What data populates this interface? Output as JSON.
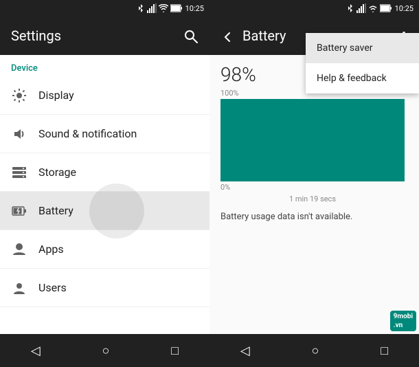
{
  "left": {
    "status_bar": {
      "time": "10:25"
    },
    "app_bar": {
      "title": "Settings",
      "search_icon": "🔍"
    },
    "section": {
      "label": "Device"
    },
    "menu_items": [
      {
        "id": "display",
        "label": "Display",
        "icon": "☀"
      },
      {
        "id": "sound",
        "label": "Sound & notification",
        "icon": "🔔"
      },
      {
        "id": "storage",
        "label": "Storage",
        "icon": "☰"
      },
      {
        "id": "battery",
        "label": "Battery",
        "icon": "🔋",
        "active": true
      },
      {
        "id": "apps",
        "label": "Apps",
        "icon": "🤖"
      },
      {
        "id": "users",
        "label": "Users",
        "icon": "👤"
      }
    ],
    "nav_bar": {
      "back": "◁",
      "home": "○",
      "recent": "□"
    }
  },
  "right": {
    "status_bar": {
      "time": "10:25"
    },
    "app_bar": {
      "title": "Battery",
      "back_icon": "←"
    },
    "battery_percent": "98%",
    "chart": {
      "label_100": "100%",
      "label_0": "0%",
      "time_label": "1 min 19 secs",
      "color": "#00897b"
    },
    "info_text": "Battery usage data isn't available.",
    "dropdown": {
      "items": [
        {
          "id": "battery-saver",
          "label": "Battery saver",
          "highlighted": true
        },
        {
          "id": "help-feedback",
          "label": "Help & feedback",
          "highlighted": false
        }
      ]
    },
    "nav_bar": {
      "back": "◁",
      "home": "○",
      "recent": "□"
    },
    "watermark": {
      "line1": "9mobi",
      "line2": ".vn"
    }
  }
}
